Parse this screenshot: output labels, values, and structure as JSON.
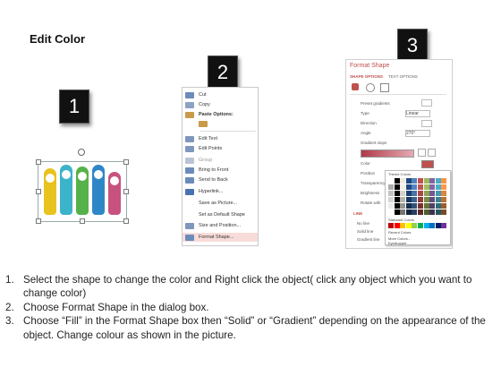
{
  "title": "Edit Color",
  "steps": [
    {
      "number": "1"
    },
    {
      "number": "2"
    },
    {
      "number": "3"
    }
  ],
  "context_menu": {
    "items": [
      "Cut",
      "Copy",
      "Paste Options:",
      "Edit Text",
      "Edit Points",
      "Group",
      "Bring to Front",
      "Send to Back",
      "Hyperlink...",
      "Save as Picture...",
      "Set as Default Shape",
      "Size and Position...",
      "Format Shape..."
    ],
    "highlight_color": "#f8dcd9"
  },
  "format_shape": {
    "title": "Format Shape",
    "tabs": [
      "SHAPE OPTIONS",
      "TEXT OPTIONS"
    ],
    "rows": [
      "Preset gradients",
      "Type",
      "Direction",
      "Angle",
      "Gradient stops",
      "Color",
      "Position",
      "Transparency",
      "Brightness",
      "Rotate with"
    ],
    "type_value": "Linear",
    "angle_value": "270°",
    "line_section": "LINE",
    "line_options": [
      "No line",
      "Solid line",
      "Gradient line"
    ],
    "palette": {
      "header": "Theme Colors",
      "standard": "Standard Colors",
      "recent": "Recent Colors",
      "more": "More Colors...",
      "eyedropper": "Eyedropper"
    },
    "accent_color": "#c0504d"
  },
  "instructions": [
    {
      "num": "1.",
      "text": "Select the shape to change the color and Right click the object( click any object which you want to change color)"
    },
    {
      "num": "2.",
      "text": "Choose Format Shape in the dialog box."
    },
    {
      "num": "3.",
      "text": "Choose “Fill” in the Format Shape box then “Solid” or “Gradient” depending on the appearance of the object. Change colour as shown in the picture."
    }
  ],
  "shape_colors": [
    "#e8c21e",
    "#3bb3c8",
    "#55b24a",
    "#2f86c7",
    "#c8527f"
  ]
}
